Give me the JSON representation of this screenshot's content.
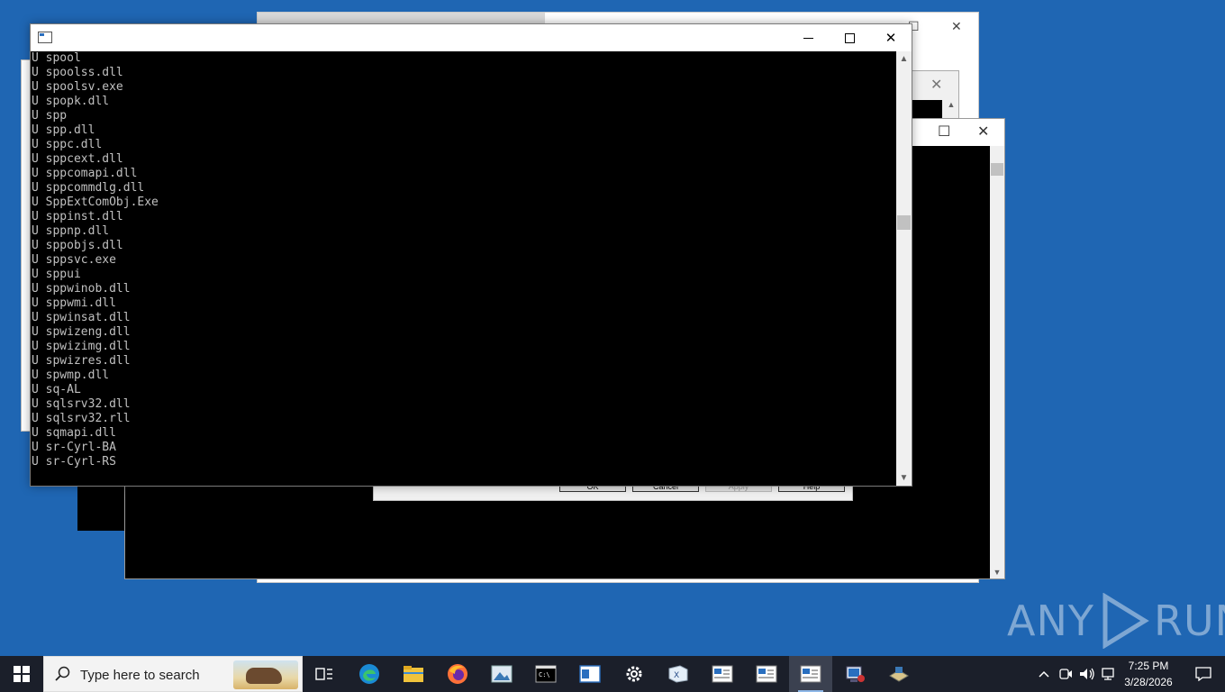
{
  "desktop": {
    "background_color": "#1f66b3"
  },
  "background_windows": {
    "dialog_buttons": [
      {
        "label": "OK",
        "enabled": true
      },
      {
        "label": "Cancel",
        "enabled": true
      },
      {
        "label": "Apply",
        "enabled": false
      },
      {
        "label": "Help",
        "enabled": true
      }
    ]
  },
  "console": {
    "title": "",
    "lines": [
      "U spool",
      "U spoolss.dll",
      "U spoolsv.exe",
      "U spopk.dll",
      "U spp",
      "U spp.dll",
      "U sppc.dll",
      "U sppcext.dll",
      "U sppcomapi.dll",
      "U sppcommdlg.dll",
      "U SppExtComObj.Exe",
      "U sppinst.dll",
      "U sppnp.dll",
      "U sppobjs.dll",
      "U sppsvc.exe",
      "U sppui",
      "U sppwinob.dll",
      "U sppwmi.dll",
      "U spwinsat.dll",
      "U spwizeng.dll",
      "U spwizimg.dll",
      "U spwizres.dll",
      "U spwmp.dll",
      "U sq-AL",
      "U sqlsrv32.dll",
      "U sqlsrv32.rll",
      "U sqmapi.dll",
      "U sr-Cyrl-BA",
      "U sr-Cyrl-RS"
    ],
    "text_color": "#c0c0c0",
    "background_color": "#000000"
  },
  "watermark": {
    "left": "ANY",
    "right": "RUN"
  },
  "taskbar": {
    "search_placeholder": "Type here to search",
    "pinned": [
      {
        "name": "task-view-icon"
      },
      {
        "name": "edge-icon"
      },
      {
        "name": "file-explorer-icon"
      },
      {
        "name": "firefox-icon"
      },
      {
        "name": "photo-viewer-icon"
      },
      {
        "name": "command-prompt-icon"
      },
      {
        "name": "window-app-icon"
      },
      {
        "name": "settings-gear-icon"
      },
      {
        "name": "xps-viewer-icon"
      },
      {
        "name": "console-window-icon-1"
      },
      {
        "name": "console-window-icon-2"
      },
      {
        "name": "console-window-icon-3"
      },
      {
        "name": "system-properties-icon"
      },
      {
        "name": "control-panel-icon"
      }
    ],
    "time": "7:25 PM",
    "date": "3/28/2026"
  }
}
